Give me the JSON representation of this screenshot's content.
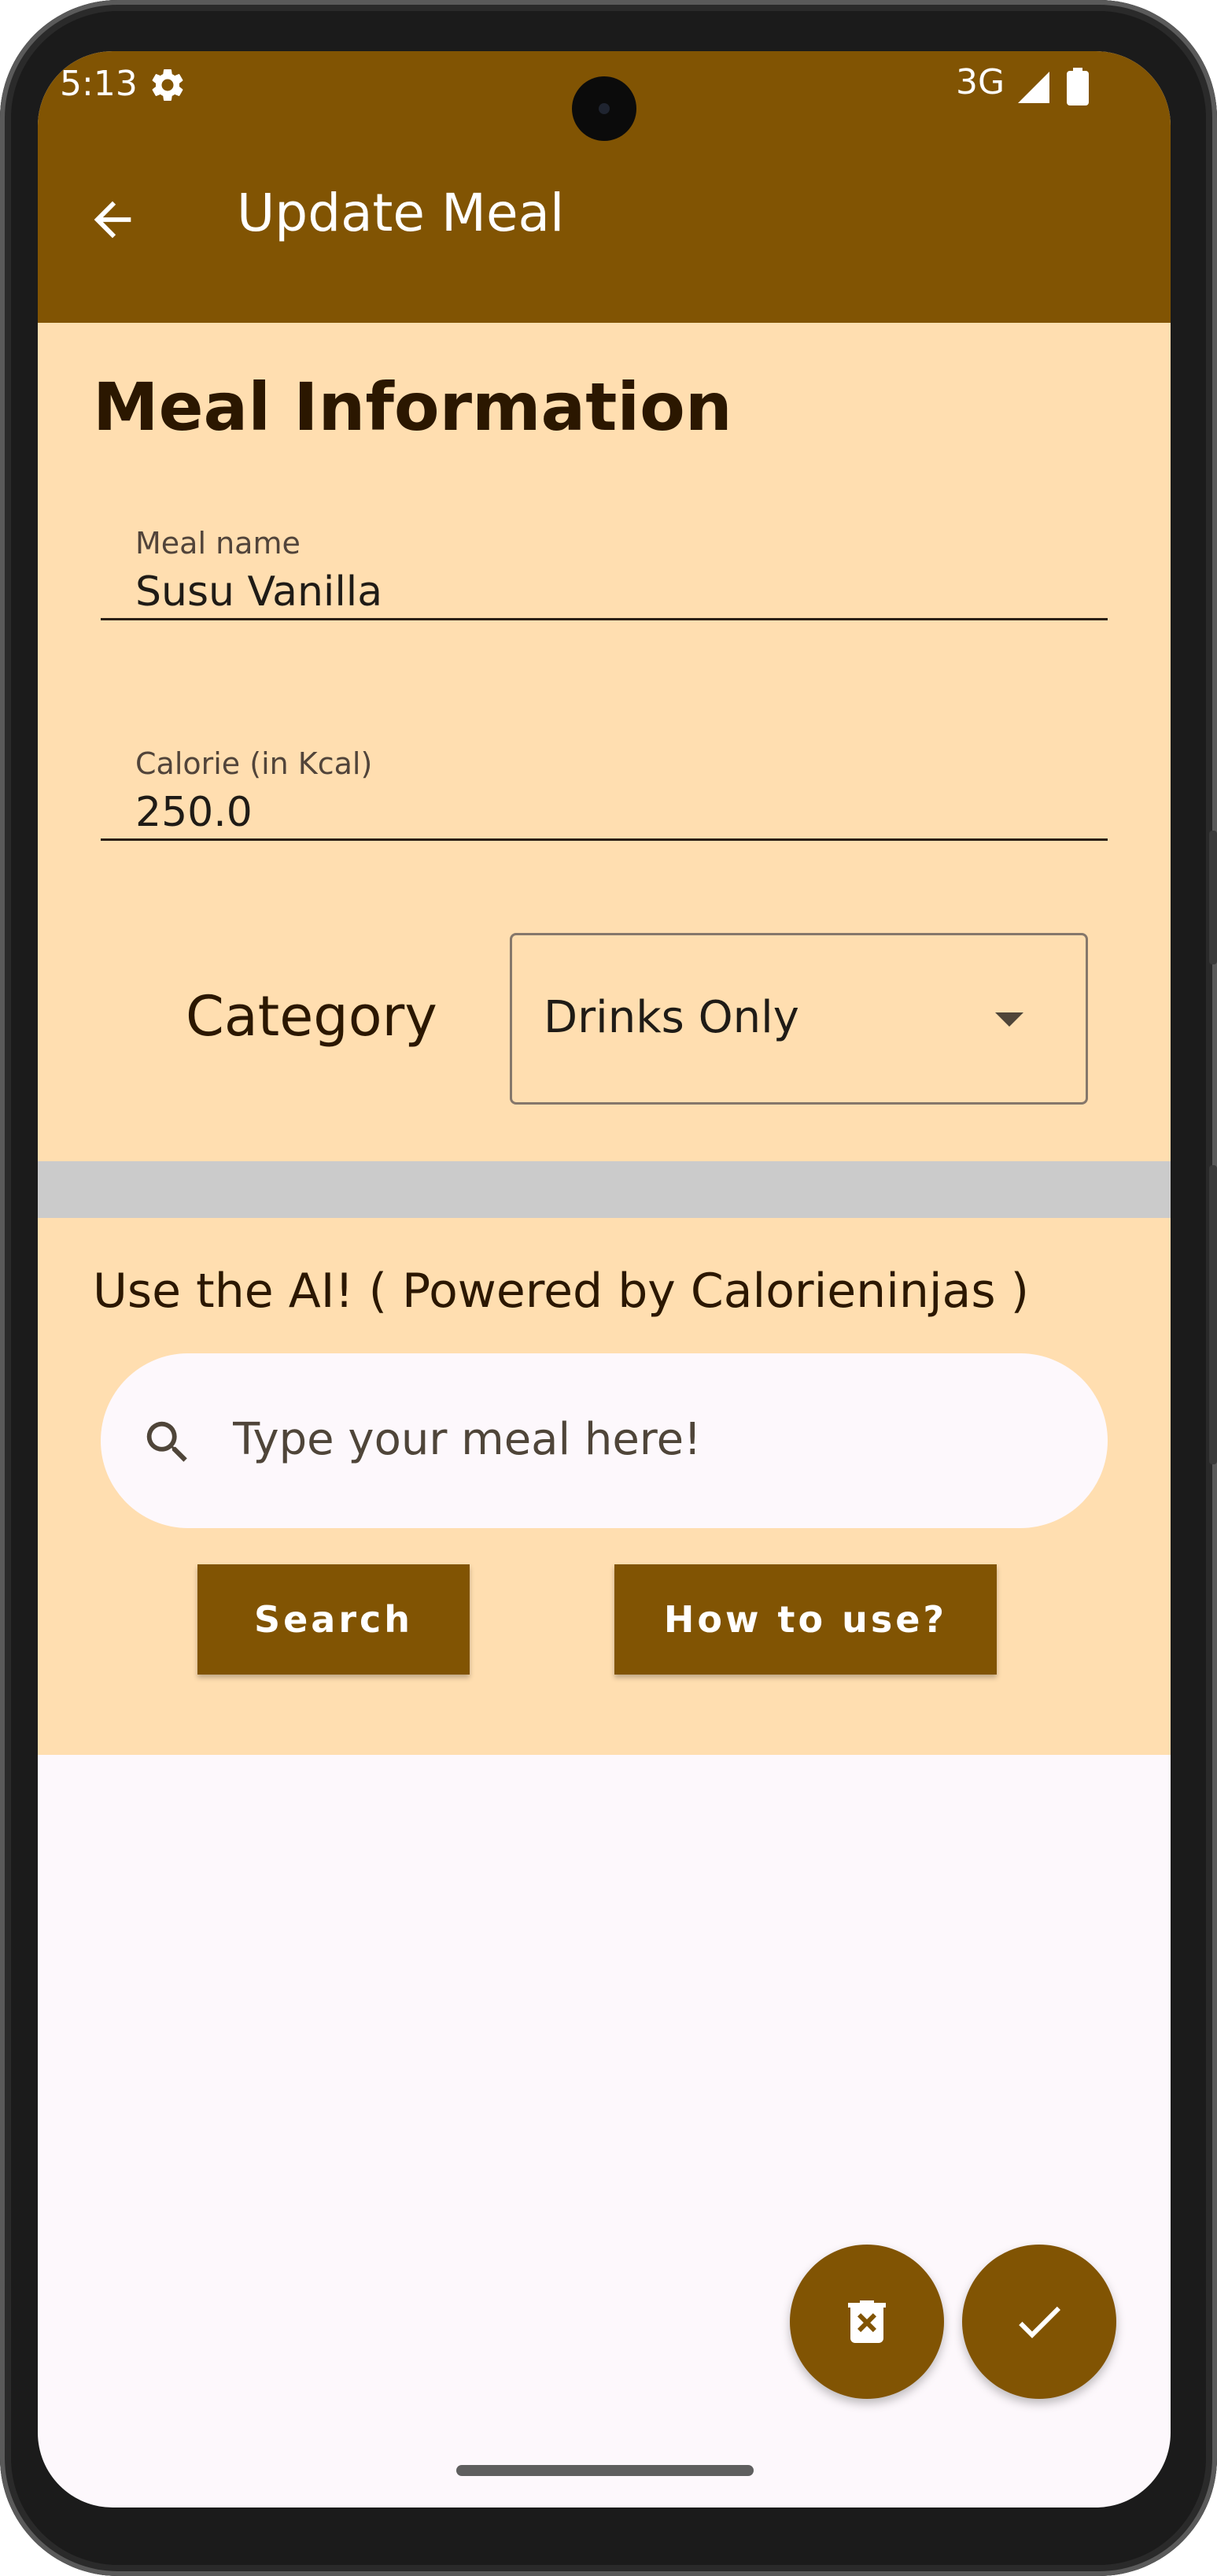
{
  "status_bar": {
    "time": "5:13",
    "network": "3G",
    "icons": [
      "gear-icon",
      "signal-icon",
      "battery-icon"
    ]
  },
  "app_bar": {
    "title": "Update Meal",
    "back_icon": "arrow-back-icon"
  },
  "meal_info": {
    "title": "Meal Information",
    "meal_name": {
      "label": "Meal name",
      "value": "Susu Vanilla"
    },
    "calorie": {
      "label": "Calorie (in Kcal)",
      "value": "250.0"
    },
    "category": {
      "label": "Category",
      "selected": "Drinks Only"
    }
  },
  "ai_section": {
    "title": "Use the AI! ( Powered by Calorieninjas )",
    "search_placeholder": "Type your meal here!",
    "search_button": "Search",
    "how_to_button": "How to use?"
  },
  "fabs": {
    "delete_icon": "delete-icon",
    "confirm_icon": "check-icon"
  },
  "colors": {
    "primary": "#815403",
    "section_bg": "#ffdeb0",
    "divider": "#cbcbcb",
    "page_bg": "#fdf8fc"
  }
}
